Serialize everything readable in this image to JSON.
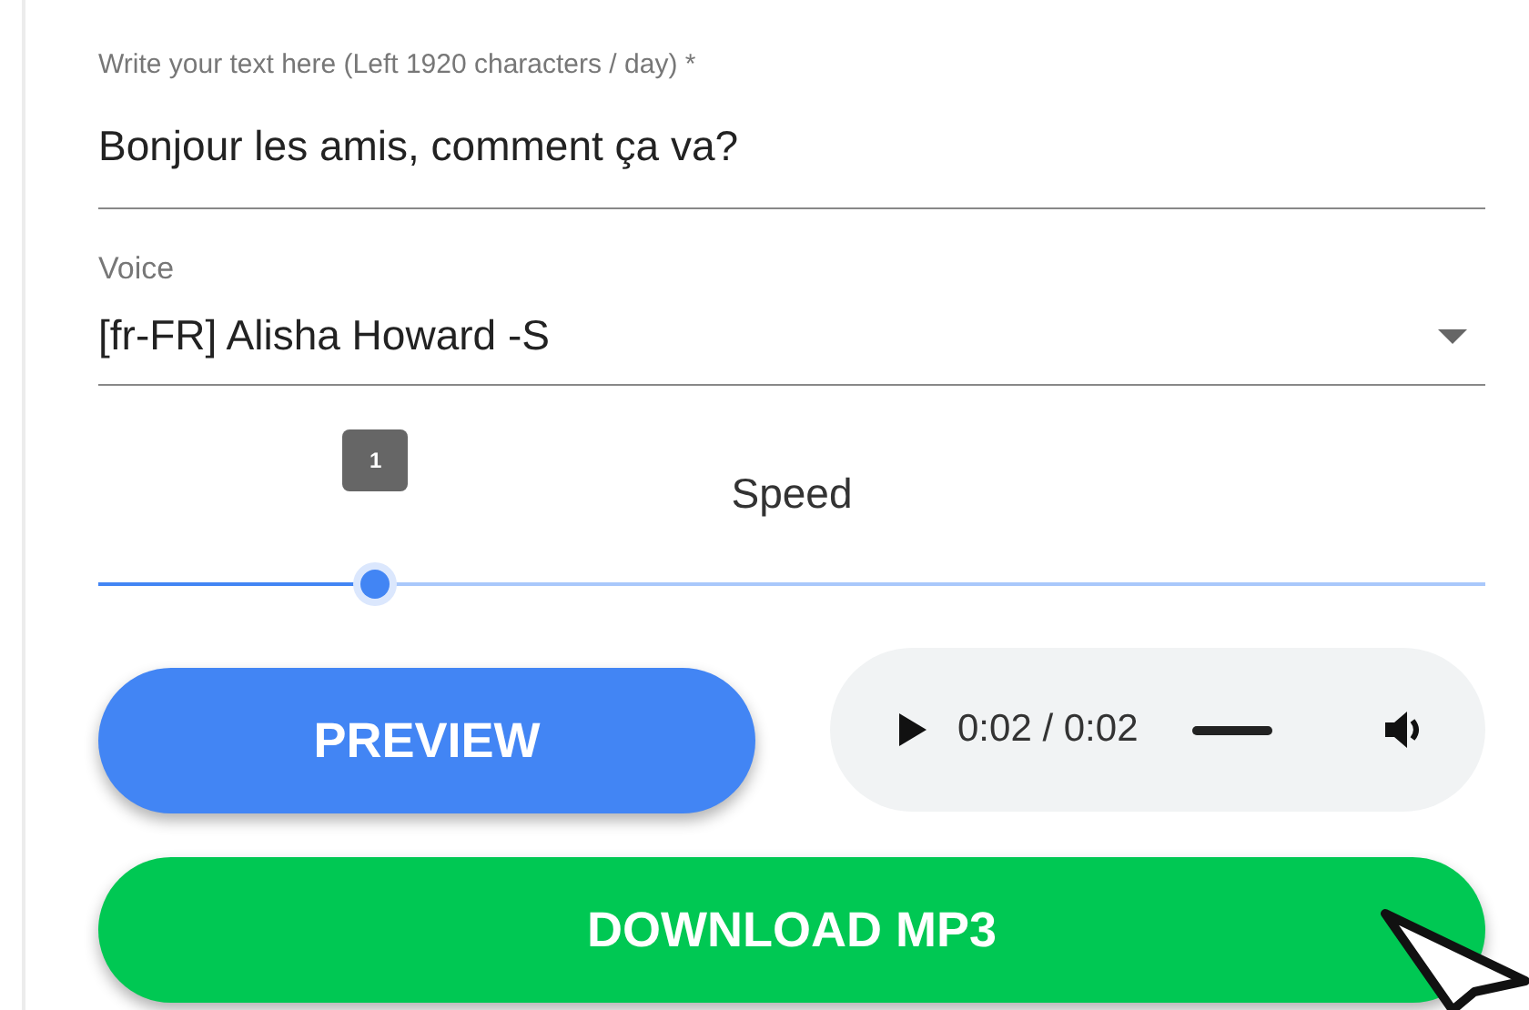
{
  "text_field": {
    "label": "Write your text here (Left 1920 characters / day) *",
    "value": "Bonjour les amis, comment ça va?"
  },
  "voice_select": {
    "label": "Voice",
    "value": "[fr-FR] Alisha Howard -S"
  },
  "speed": {
    "label": "Speed",
    "value_label": "1",
    "level": 0.2
  },
  "preview_button": {
    "label": "PREVIEW"
  },
  "player": {
    "time": "0:02 / 0:02",
    "progress": {
      "level": 1
    }
  },
  "download_button": {
    "label": "DOWNLOAD MP3"
  }
}
